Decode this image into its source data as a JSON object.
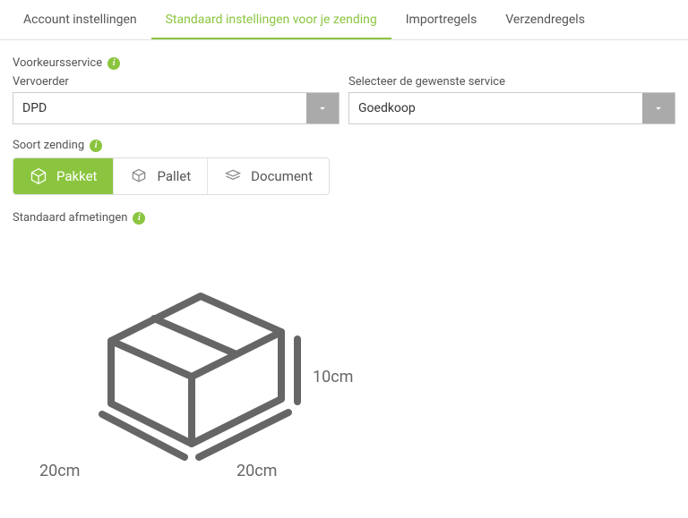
{
  "tabs": {
    "account": "Account instellingen",
    "defaults": "Standaard instellingen voor je zending",
    "import": "Importregels",
    "shipping": "Verzendregels"
  },
  "preferred": {
    "label": "Voorkeursservice",
    "carrier_label": "Vervoerder",
    "carrier_value": "DPD",
    "service_label": "Selecteer de gewenste service",
    "service_value": "Goedkoop"
  },
  "shipment_type": {
    "label": "Soort zending",
    "options": {
      "pakket": "Pakket",
      "pallet": "Pallet",
      "document": "Document"
    }
  },
  "dimensions": {
    "label": "Standaard afmetingen",
    "length": "20cm",
    "width": "20cm",
    "height": "10cm"
  }
}
